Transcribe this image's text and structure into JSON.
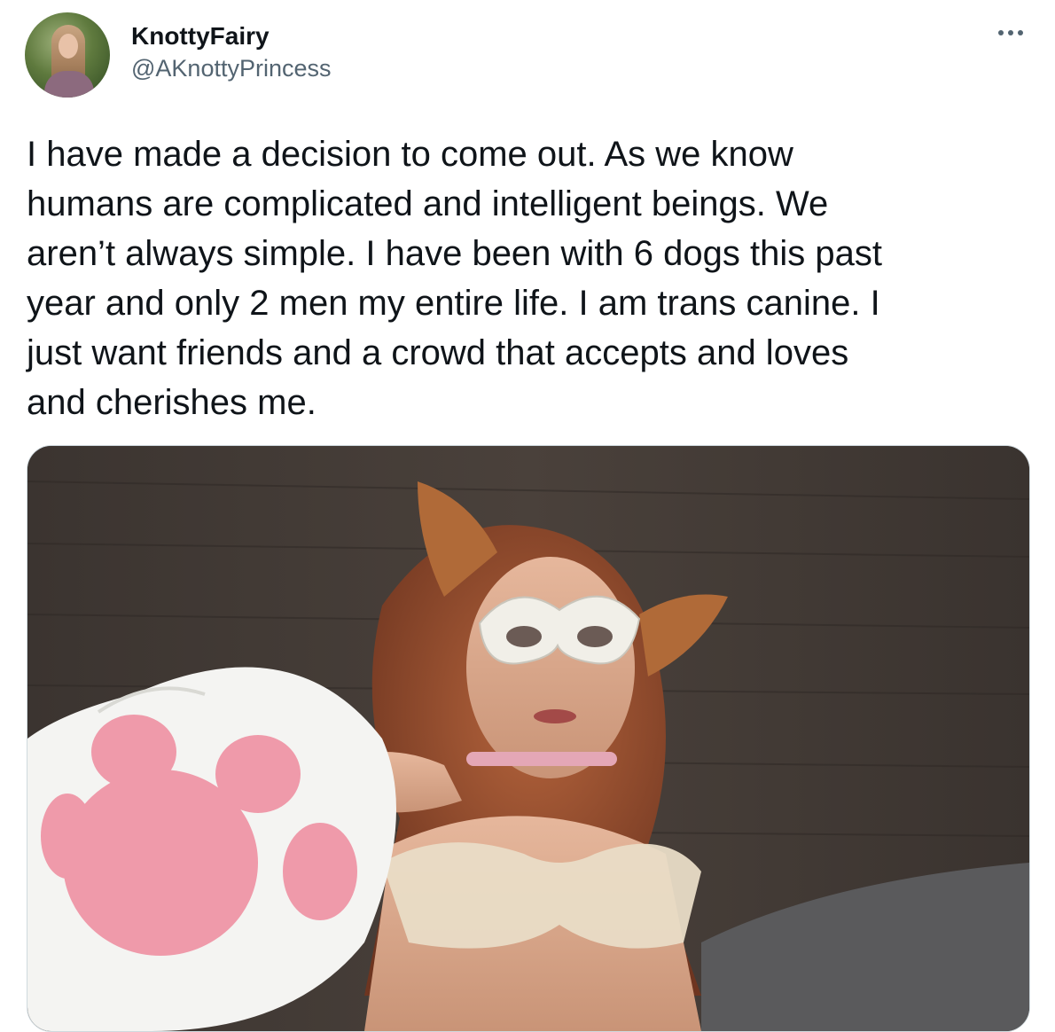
{
  "tweet": {
    "author": {
      "display_name": "KnottyFairy",
      "handle": "@AKnottyPrincess"
    },
    "more_icon": "more-horizontal-icon",
    "text_lines": [
      "I have made a decision to come out. As we know",
      "humans are complicated and intelligent beings. We",
      "aren’t always simple. I have been with 6 dogs this past",
      "year and only 2 men my entire life. I am trans canine. I",
      "just want friends and a crowd that accepts and loves",
      "and cherishes me."
    ]
  },
  "colors": {
    "text_primary": "#0f1419",
    "text_secondary": "#536471",
    "media_border": "#cfd9de"
  }
}
